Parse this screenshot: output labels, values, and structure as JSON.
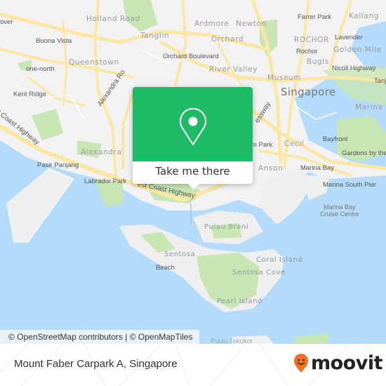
{
  "map": {
    "labels": {
      "holland_road": "Holland Road",
      "tanglin": "Tanglin",
      "ardmore": "Ardmore",
      "newton": "Newton",
      "farrer_park": "Farrer Park",
      "kallang": "Kallang",
      "rover": "over",
      "buona_vista": "Buona Vista",
      "orchard": "Orchard",
      "rochor_area": "ROCHOR",
      "lavender": "Lavender",
      "orchard_boulevard": "Orchard Boulevard",
      "rochor": "Rochor",
      "golden_mile": "Golden Mile",
      "queenstown": "Queenstown",
      "bugis": "Bugis",
      "one_north": "one-north",
      "river_valley": "River Valley",
      "nicoll_highway": "Nicoll Highway",
      "museum": "Museum",
      "kent_ridge": "Kent Ridge",
      "singapore": "Singapore",
      "tanjong": "Tanj",
      "marina": "Marina P",
      "alexandra_road": "Alexandra Ro",
      "expressway": "essway",
      "coast_highway_west": "t Coast Highway",
      "bayfront": "Bayfront",
      "alexandra": "Alexandra",
      "park": "m Park",
      "cecil": "Cecil",
      "gardens": "Gardens by the",
      "pasir_panjang": "Pasir Panjang",
      "anson": "Anson",
      "marina_bay": "Marina Bay",
      "labrador_park": "Labrador Park",
      "west_coast_highway": "est Coast Highway",
      "marina_south_pier": "Marina South Pier",
      "marina_bay_cruise_1": "Marina Bay",
      "marina_bay_cruise_2": "Cruise Centre",
      "pulau_brani": "Pulau Brani",
      "sentosa": "Sentosa",
      "coral_island": "Coral Island",
      "beach": "Beach",
      "sentosa_cove": "Sentosa Cove",
      "pearl_island": "Pearl Island",
      "pulau_tekukor": "Pulau Tekukor"
    },
    "colors": {
      "land": "#f2f2f3",
      "water": "#b4dcfa",
      "park": "#c8e6b4",
      "road": "#fbe7a4"
    }
  },
  "popup": {
    "icon": "map-pin-icon",
    "cta_label": "Take me there",
    "color": "#1fba66"
  },
  "attribution": {
    "osm": "© OpenStreetMap contributors",
    "separator": " | ",
    "omt": "© OpenMapTiles"
  },
  "footer": {
    "location_title": "Mount Faber Carpark A, Singapore",
    "brand": "moovit",
    "brand_color": "#f36f21"
  }
}
